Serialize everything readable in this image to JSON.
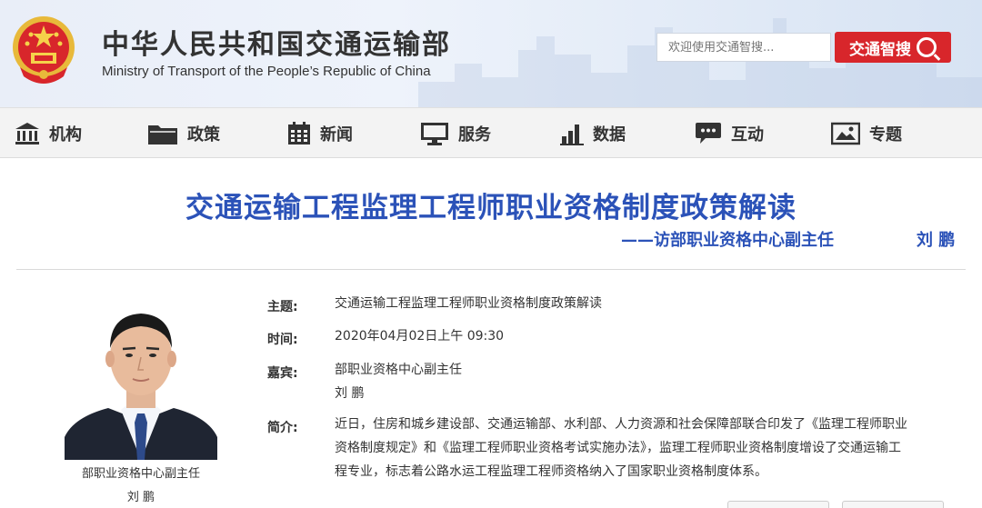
{
  "header": {
    "title": "中华人民共和国交通运输部",
    "subtitle": "Ministry of Transport of the People’s Republic of China",
    "search_placeholder": "欢迎使用交通智搜...",
    "search_button": "交通智搜",
    "emblem_color": "#d8262b"
  },
  "nav": {
    "items": [
      {
        "label": "机构",
        "icon": "building-icon"
      },
      {
        "label": "政策",
        "icon": "folder-icon"
      },
      {
        "label": "新闻",
        "icon": "calendar-icon"
      },
      {
        "label": "服务",
        "icon": "monitor-icon"
      },
      {
        "label": "数据",
        "icon": "bar-chart-icon"
      },
      {
        "label": "互动",
        "icon": "chat-icon"
      },
      {
        "label": "专题",
        "icon": "image-icon"
      }
    ]
  },
  "article": {
    "title": "交通运输工程监理工程师职业资格制度政策解读",
    "subtitle": "——访部职业资格中心副主任",
    "guest_name": "刘 鹏"
  },
  "photo": {
    "caption": "部职业资格中心副主任",
    "name": "刘 鹏"
  },
  "info": {
    "topic_label": "主题:",
    "topic": "交通运输工程监理工程师职业资格制度政策解读",
    "time_label": "时间:",
    "time": "2020年04月02日上午 09:30",
    "guest_label": "嘉宾:",
    "guest_title": "部职业资格中心副主任",
    "guest_name": "刘 鹏",
    "intro_label": "简介:",
    "intro_lines": [
      "近日，住房和城乡建设部、交通运输部、水利部、人力资源和社会保障部联合印发了《监理工程师职业",
      "资格制度规定》和《监理工程师职业资格考试实施办法》，监理工程师职业资格制度增设了交通运输工",
      "程专业，标志着公路水运工程监理工程师资格纳入了国家职业资格制度体系。"
    ]
  },
  "colors": {
    "accent": "#2b52b8",
    "brand_red": "#d8262b"
  }
}
